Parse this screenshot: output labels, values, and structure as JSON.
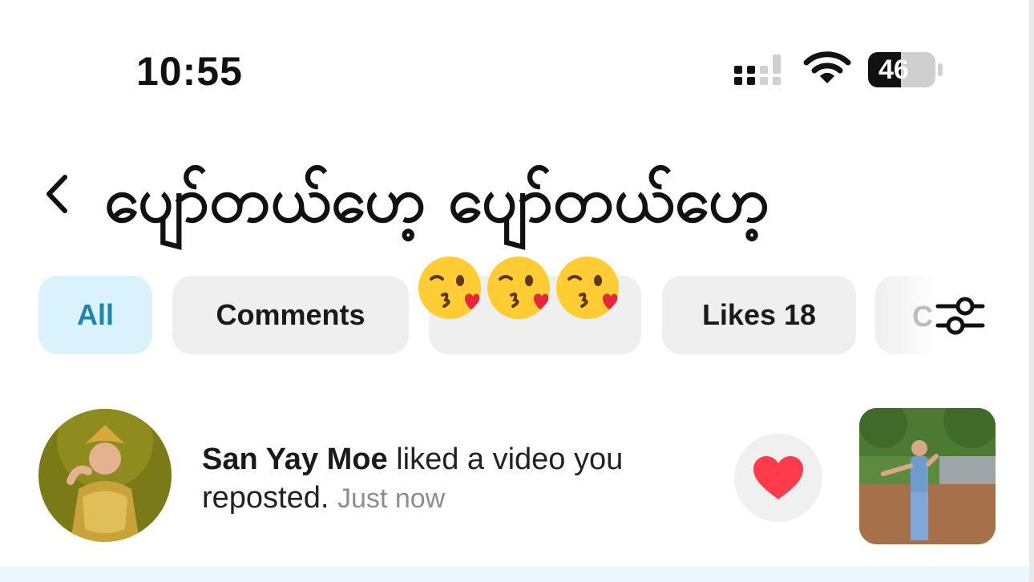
{
  "status_bar": {
    "time": "10:55",
    "battery_level": "46"
  },
  "overlay": {
    "title": "ပျော်တယ်ဟေ့ ပျော်တယ်ဟေ့",
    "emojis": [
      "kissing-face-with-heart-icon",
      "kissing-face-with-heart-icon",
      "kissing-face-with-heart-icon"
    ]
  },
  "tabs": [
    {
      "label": "All",
      "active": true
    },
    {
      "label": "Comments",
      "active": false
    },
    {
      "label": "",
      "active": false
    },
    {
      "label": "Likes 18",
      "active": false
    },
    {
      "label": "C",
      "active": false
    }
  ],
  "notification": {
    "user_name": "San Yay Moe",
    "action": " liked a video you reposted.",
    "time_ago": "Just now"
  },
  "colors": {
    "active_tab_bg": "#d9f2fb",
    "active_tab_text": "#1f84b3",
    "heart": "#ff3b4b"
  },
  "icons": {
    "back": "chevron-left-icon",
    "filter": "sliders-icon",
    "like": "heart-icon"
  }
}
